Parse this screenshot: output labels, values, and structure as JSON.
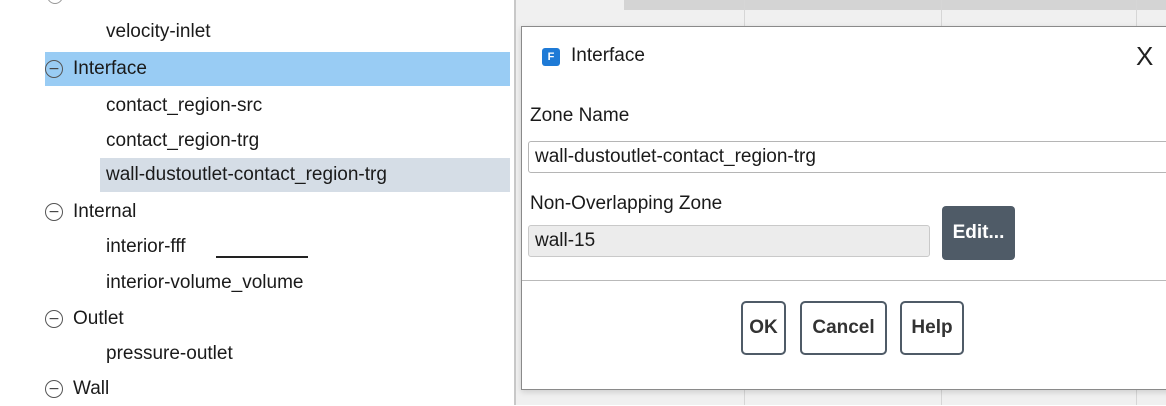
{
  "tree": {
    "items": [
      {
        "type": "leaf",
        "label": "velocity-inlet"
      },
      {
        "type": "group",
        "label": "Interface",
        "selected": true
      },
      {
        "type": "leaf",
        "label": "contact_region-src"
      },
      {
        "type": "leaf",
        "label": "contact_region-trg"
      },
      {
        "type": "leaf",
        "label": "wall-dustoutlet-contact_region-trg",
        "highlighted": true
      },
      {
        "type": "group",
        "label": "Internal"
      },
      {
        "type": "leaf",
        "label": "interior-fff"
      },
      {
        "type": "leaf",
        "label": "interior-volume_volume"
      },
      {
        "type": "group",
        "label": "Outlet"
      },
      {
        "type": "leaf",
        "label": "pressure-outlet"
      },
      {
        "type": "group",
        "label": "Wall"
      }
    ]
  },
  "dialog": {
    "app_icon_letter": "F",
    "title": "Interface",
    "close_glyph": "X",
    "zone_name_label": "Zone Name",
    "zone_name_value": "wall-dustoutlet-contact_region-trg",
    "non_overlapping_label": "Non-Overlapping Zone",
    "non_overlapping_value": "wall-15",
    "edit_label": "Edit...",
    "ok_label": "OK",
    "cancel_label": "Cancel",
    "help_label": "Help"
  },
  "colors": {
    "selected_group_bg": "#99ccf4",
    "highlighted_leaf_bg": "#d5dde6",
    "edit_button_bg": "#4f5b67",
    "app_icon_bg": "#1e7ad6"
  }
}
